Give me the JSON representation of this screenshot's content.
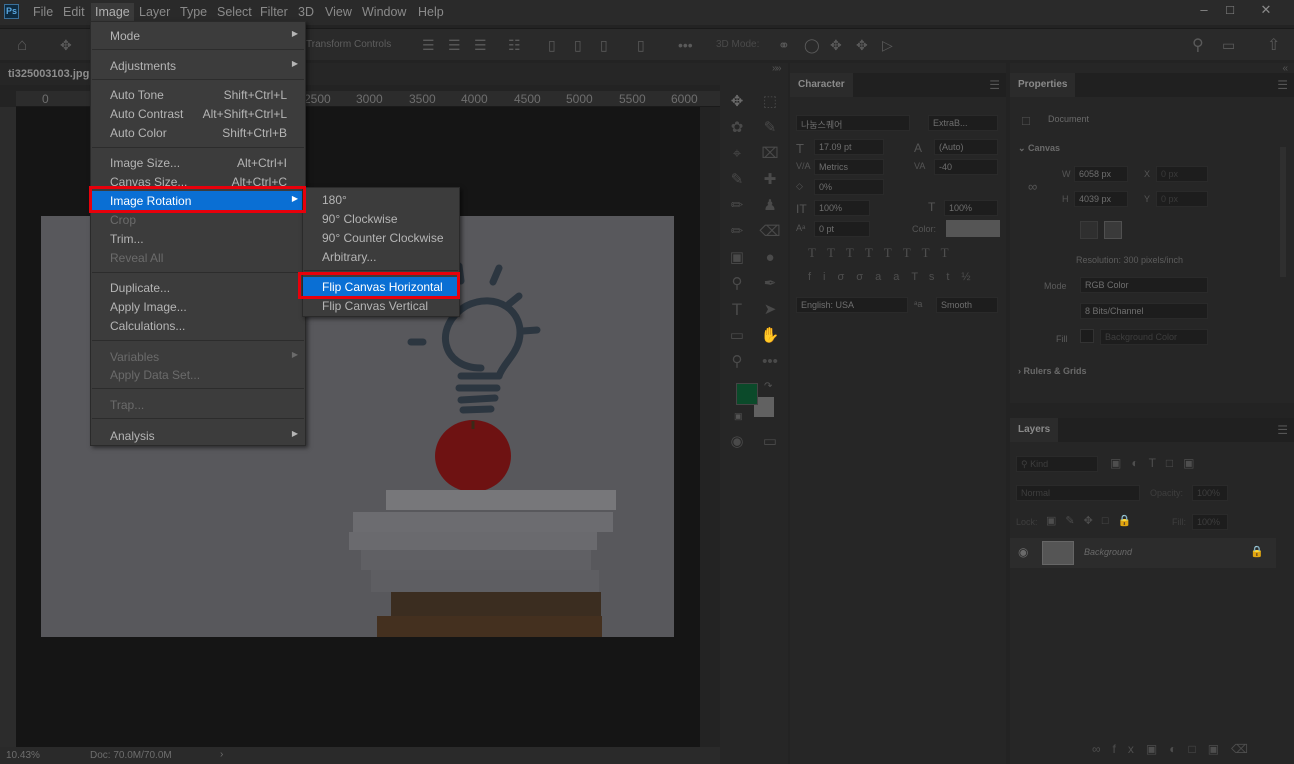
{
  "app": {
    "logo": "Ps"
  },
  "menubar": {
    "items": [
      "File",
      "Edit",
      "Image",
      "Layer",
      "Type",
      "Select",
      "Filter",
      "3D",
      "View",
      "Window",
      "Help"
    ],
    "active": "Image"
  },
  "optionsbar": {
    "transform_label": "Transform Controls",
    "mode3d_label": "3D Mode:"
  },
  "document": {
    "tab_title": "ti325003103.jpg",
    "ruler_ticks": [
      "0",
      "2500",
      "3000",
      "3500",
      "4000",
      "4500",
      "5000",
      "5500",
      "6000"
    ],
    "status_zoom": "10.43%",
    "status_doc": "Doc: 70.0M/70.0M"
  },
  "image_menu": [
    {
      "label": "Mode",
      "submenu": true
    },
    {
      "sep": true
    },
    {
      "label": "Adjustments",
      "submenu": true
    },
    {
      "sep": true
    },
    {
      "label": "Auto Tone",
      "shortcut": "Shift+Ctrl+L"
    },
    {
      "label": "Auto Contrast",
      "shortcut": "Alt+Shift+Ctrl+L"
    },
    {
      "label": "Auto Color",
      "shortcut": "Shift+Ctrl+B"
    },
    {
      "sep": true
    },
    {
      "label": "Image Size...",
      "shortcut": "Alt+Ctrl+I"
    },
    {
      "label": "Canvas Size...",
      "shortcut": "Alt+Ctrl+C"
    },
    {
      "label": "Image Rotation",
      "submenu": true,
      "highlighted": true
    },
    {
      "label": "Crop",
      "disabled": true
    },
    {
      "label": "Trim..."
    },
    {
      "label": "Reveal All",
      "disabled": true
    },
    {
      "sep": true
    },
    {
      "label": "Duplicate..."
    },
    {
      "label": "Apply Image..."
    },
    {
      "label": "Calculations..."
    },
    {
      "sep": true
    },
    {
      "label": "Variables",
      "submenu": true,
      "disabled": true
    },
    {
      "label": "Apply Data Set...",
      "disabled": true
    },
    {
      "sep": true
    },
    {
      "label": "Trap...",
      "disabled": true
    },
    {
      "sep": true
    },
    {
      "label": "Analysis",
      "submenu": true
    }
  ],
  "rotation_submenu": [
    {
      "label": "180°"
    },
    {
      "label": "90° Clockwise"
    },
    {
      "label": "90° Counter Clockwise"
    },
    {
      "label": "Arbitrary..."
    },
    {
      "sep": true
    },
    {
      "label": "Flip Canvas Horizontal",
      "highlighted": true
    },
    {
      "label": "Flip Canvas Vertical"
    }
  ],
  "character_panel": {
    "tab": "Character",
    "font_family": "나눔스퀘어",
    "font_style": "ExtraB...",
    "size": "17.09 pt",
    "leading": "(Auto)",
    "kerning": "Metrics",
    "tracking": "-40",
    "scale_pct": "0%",
    "vscale": "100%",
    "hscale": "100%",
    "baseline": "0 pt",
    "color_label": "Color:",
    "language": "English: USA",
    "antialias": "Smooth"
  },
  "properties_panel": {
    "tab": "Properties",
    "doc_label": "Document",
    "canvas_section": "Canvas",
    "w_label": "W",
    "w_value": "6058 px",
    "h_label": "H",
    "h_value": "4039 px",
    "x_label": "X",
    "x_placeholder": "0 px",
    "y_label": "Y",
    "y_placeholder": "0 px",
    "resolution": "Resolution: 300 pixels/inch",
    "mode_label": "Mode",
    "mode_value": "RGB Color",
    "bits_value": "8 Bits/Channel",
    "fill_label": "Fill",
    "fill_value": "Background Color",
    "rulers_section": "Rulers & Grids"
  },
  "layers_panel": {
    "tab": "Layers",
    "kind": "Kind",
    "blend_mode": "Normal",
    "opacity_label": "Opacity:",
    "opacity_value": "100%",
    "lock_label": "Lock:",
    "fill_label": "Fill:",
    "fill_value": "100%",
    "layer_name": "Background"
  },
  "colors": {
    "foreground": "#0b4a2a",
    "background": "#ffffff",
    "highlight": "#0a6fd4",
    "annotation": "#e8000b"
  }
}
